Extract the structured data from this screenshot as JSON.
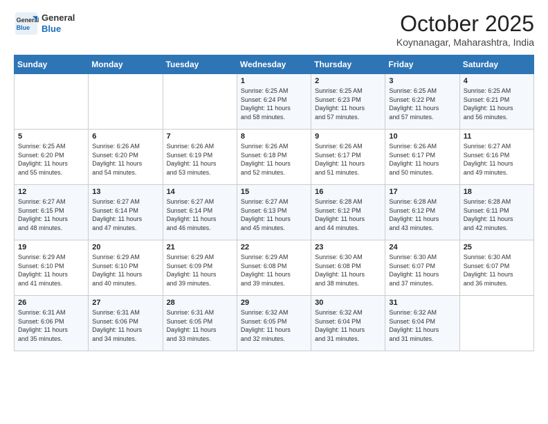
{
  "header": {
    "logo": {
      "general": "General",
      "blue": "Blue"
    },
    "month": "October 2025",
    "location": "Koynanagar, Maharashtra, India"
  },
  "days_of_week": [
    "Sunday",
    "Monday",
    "Tuesday",
    "Wednesday",
    "Thursday",
    "Friday",
    "Saturday"
  ],
  "weeks": [
    [
      {
        "day": "",
        "info": ""
      },
      {
        "day": "",
        "info": ""
      },
      {
        "day": "",
        "info": ""
      },
      {
        "day": "1",
        "info": "Sunrise: 6:25 AM\nSunset: 6:24 PM\nDaylight: 11 hours\nand 58 minutes."
      },
      {
        "day": "2",
        "info": "Sunrise: 6:25 AM\nSunset: 6:23 PM\nDaylight: 11 hours\nand 57 minutes."
      },
      {
        "day": "3",
        "info": "Sunrise: 6:25 AM\nSunset: 6:22 PM\nDaylight: 11 hours\nand 57 minutes."
      },
      {
        "day": "4",
        "info": "Sunrise: 6:25 AM\nSunset: 6:21 PM\nDaylight: 11 hours\nand 56 minutes."
      }
    ],
    [
      {
        "day": "5",
        "info": "Sunrise: 6:25 AM\nSunset: 6:20 PM\nDaylight: 11 hours\nand 55 minutes."
      },
      {
        "day": "6",
        "info": "Sunrise: 6:26 AM\nSunset: 6:20 PM\nDaylight: 11 hours\nand 54 minutes."
      },
      {
        "day": "7",
        "info": "Sunrise: 6:26 AM\nSunset: 6:19 PM\nDaylight: 11 hours\nand 53 minutes."
      },
      {
        "day": "8",
        "info": "Sunrise: 6:26 AM\nSunset: 6:18 PM\nDaylight: 11 hours\nand 52 minutes."
      },
      {
        "day": "9",
        "info": "Sunrise: 6:26 AM\nSunset: 6:17 PM\nDaylight: 11 hours\nand 51 minutes."
      },
      {
        "day": "10",
        "info": "Sunrise: 6:26 AM\nSunset: 6:17 PM\nDaylight: 11 hours\nand 50 minutes."
      },
      {
        "day": "11",
        "info": "Sunrise: 6:27 AM\nSunset: 6:16 PM\nDaylight: 11 hours\nand 49 minutes."
      }
    ],
    [
      {
        "day": "12",
        "info": "Sunrise: 6:27 AM\nSunset: 6:15 PM\nDaylight: 11 hours\nand 48 minutes."
      },
      {
        "day": "13",
        "info": "Sunrise: 6:27 AM\nSunset: 6:14 PM\nDaylight: 11 hours\nand 47 minutes."
      },
      {
        "day": "14",
        "info": "Sunrise: 6:27 AM\nSunset: 6:14 PM\nDaylight: 11 hours\nand 46 minutes."
      },
      {
        "day": "15",
        "info": "Sunrise: 6:27 AM\nSunset: 6:13 PM\nDaylight: 11 hours\nand 45 minutes."
      },
      {
        "day": "16",
        "info": "Sunrise: 6:28 AM\nSunset: 6:12 PM\nDaylight: 11 hours\nand 44 minutes."
      },
      {
        "day": "17",
        "info": "Sunrise: 6:28 AM\nSunset: 6:12 PM\nDaylight: 11 hours\nand 43 minutes."
      },
      {
        "day": "18",
        "info": "Sunrise: 6:28 AM\nSunset: 6:11 PM\nDaylight: 11 hours\nand 42 minutes."
      }
    ],
    [
      {
        "day": "19",
        "info": "Sunrise: 6:29 AM\nSunset: 6:10 PM\nDaylight: 11 hours\nand 41 minutes."
      },
      {
        "day": "20",
        "info": "Sunrise: 6:29 AM\nSunset: 6:10 PM\nDaylight: 11 hours\nand 40 minutes."
      },
      {
        "day": "21",
        "info": "Sunrise: 6:29 AM\nSunset: 6:09 PM\nDaylight: 11 hours\nand 39 minutes."
      },
      {
        "day": "22",
        "info": "Sunrise: 6:29 AM\nSunset: 6:08 PM\nDaylight: 11 hours\nand 39 minutes."
      },
      {
        "day": "23",
        "info": "Sunrise: 6:30 AM\nSunset: 6:08 PM\nDaylight: 11 hours\nand 38 minutes."
      },
      {
        "day": "24",
        "info": "Sunrise: 6:30 AM\nSunset: 6:07 PM\nDaylight: 11 hours\nand 37 minutes."
      },
      {
        "day": "25",
        "info": "Sunrise: 6:30 AM\nSunset: 6:07 PM\nDaylight: 11 hours\nand 36 minutes."
      }
    ],
    [
      {
        "day": "26",
        "info": "Sunrise: 6:31 AM\nSunset: 6:06 PM\nDaylight: 11 hours\nand 35 minutes."
      },
      {
        "day": "27",
        "info": "Sunrise: 6:31 AM\nSunset: 6:06 PM\nDaylight: 11 hours\nand 34 minutes."
      },
      {
        "day": "28",
        "info": "Sunrise: 6:31 AM\nSunset: 6:05 PM\nDaylight: 11 hours\nand 33 minutes."
      },
      {
        "day": "29",
        "info": "Sunrise: 6:32 AM\nSunset: 6:05 PM\nDaylight: 11 hours\nand 32 minutes."
      },
      {
        "day": "30",
        "info": "Sunrise: 6:32 AM\nSunset: 6:04 PM\nDaylight: 11 hours\nand 31 minutes."
      },
      {
        "day": "31",
        "info": "Sunrise: 6:32 AM\nSunset: 6:04 PM\nDaylight: 11 hours\nand 31 minutes."
      },
      {
        "day": "",
        "info": ""
      }
    ]
  ]
}
